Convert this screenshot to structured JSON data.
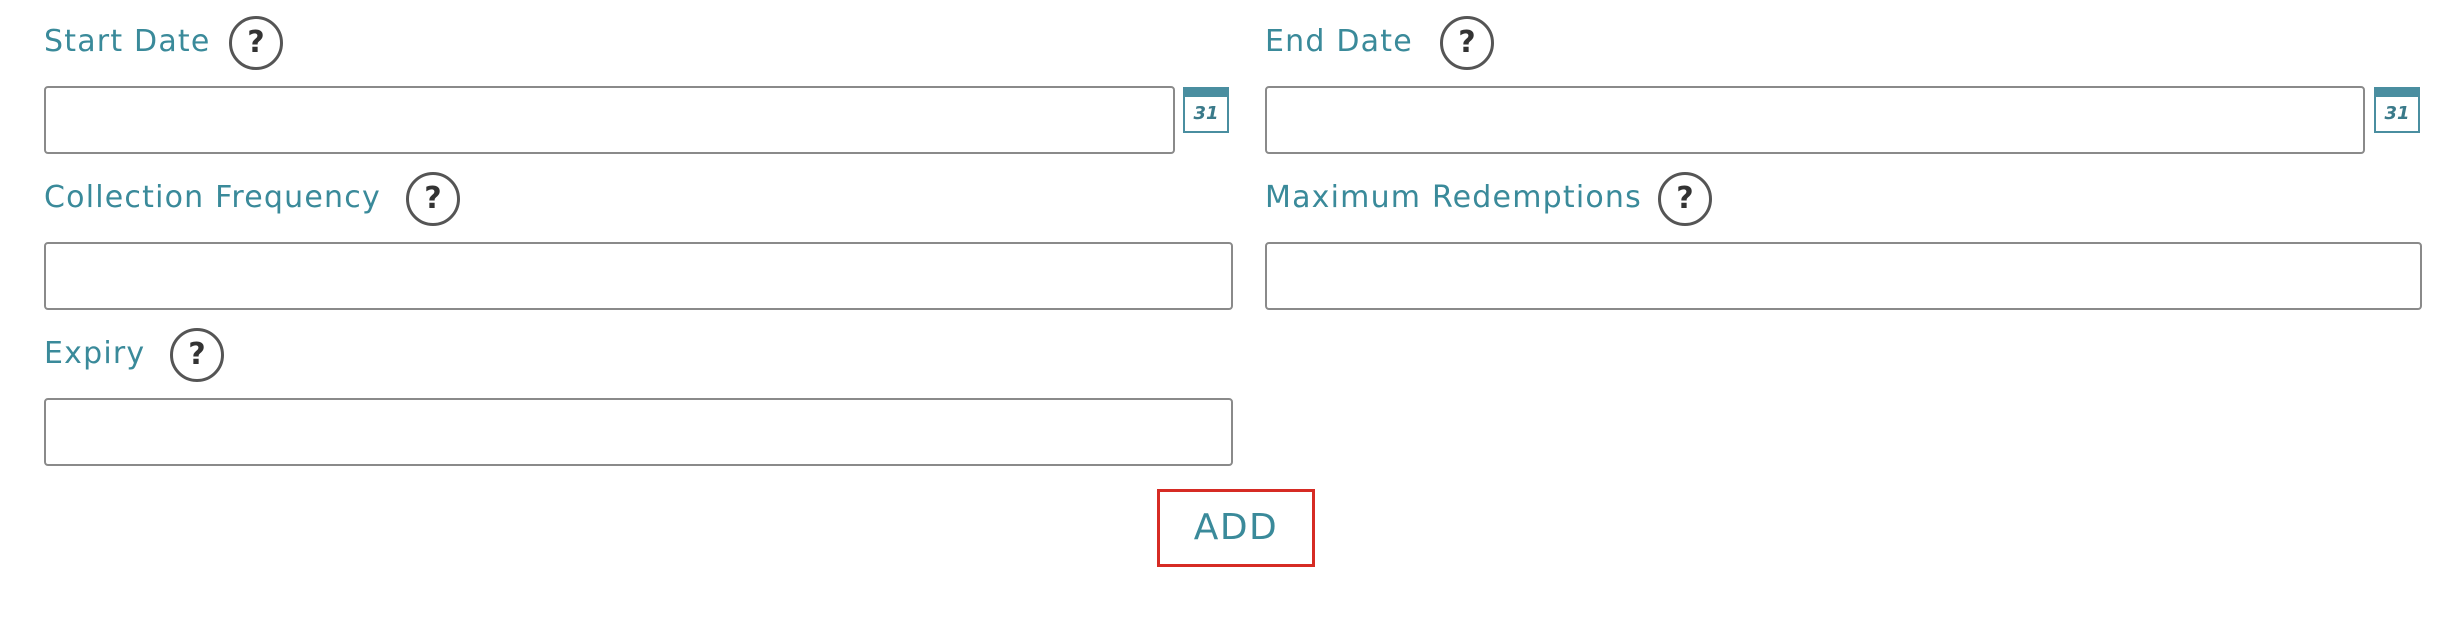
{
  "form": {
    "start_date": {
      "label": "Start Date",
      "help_icon": "?",
      "value": "",
      "calendar_day": "31"
    },
    "end_date": {
      "label": "End Date",
      "help_icon": "?",
      "value": "",
      "calendar_day": "31"
    },
    "collection_frequency": {
      "label": "Collection Frequency",
      "help_icon": "?",
      "value": ""
    },
    "maximum_redemptions": {
      "label": "Maximum Redemptions",
      "help_icon": "?",
      "value": ""
    },
    "expiry": {
      "label": "Expiry",
      "help_icon": "?",
      "value": ""
    },
    "add_label": "ADD"
  },
  "colors": {
    "label_teal": "#3a8a9a",
    "calendar_blue": "#4a8ea0",
    "add_border_red": "#d62b24",
    "input_border": "#8a8a8a"
  },
  "icons": {
    "help": "question-circle-icon",
    "calendar": "calendar-icon"
  }
}
